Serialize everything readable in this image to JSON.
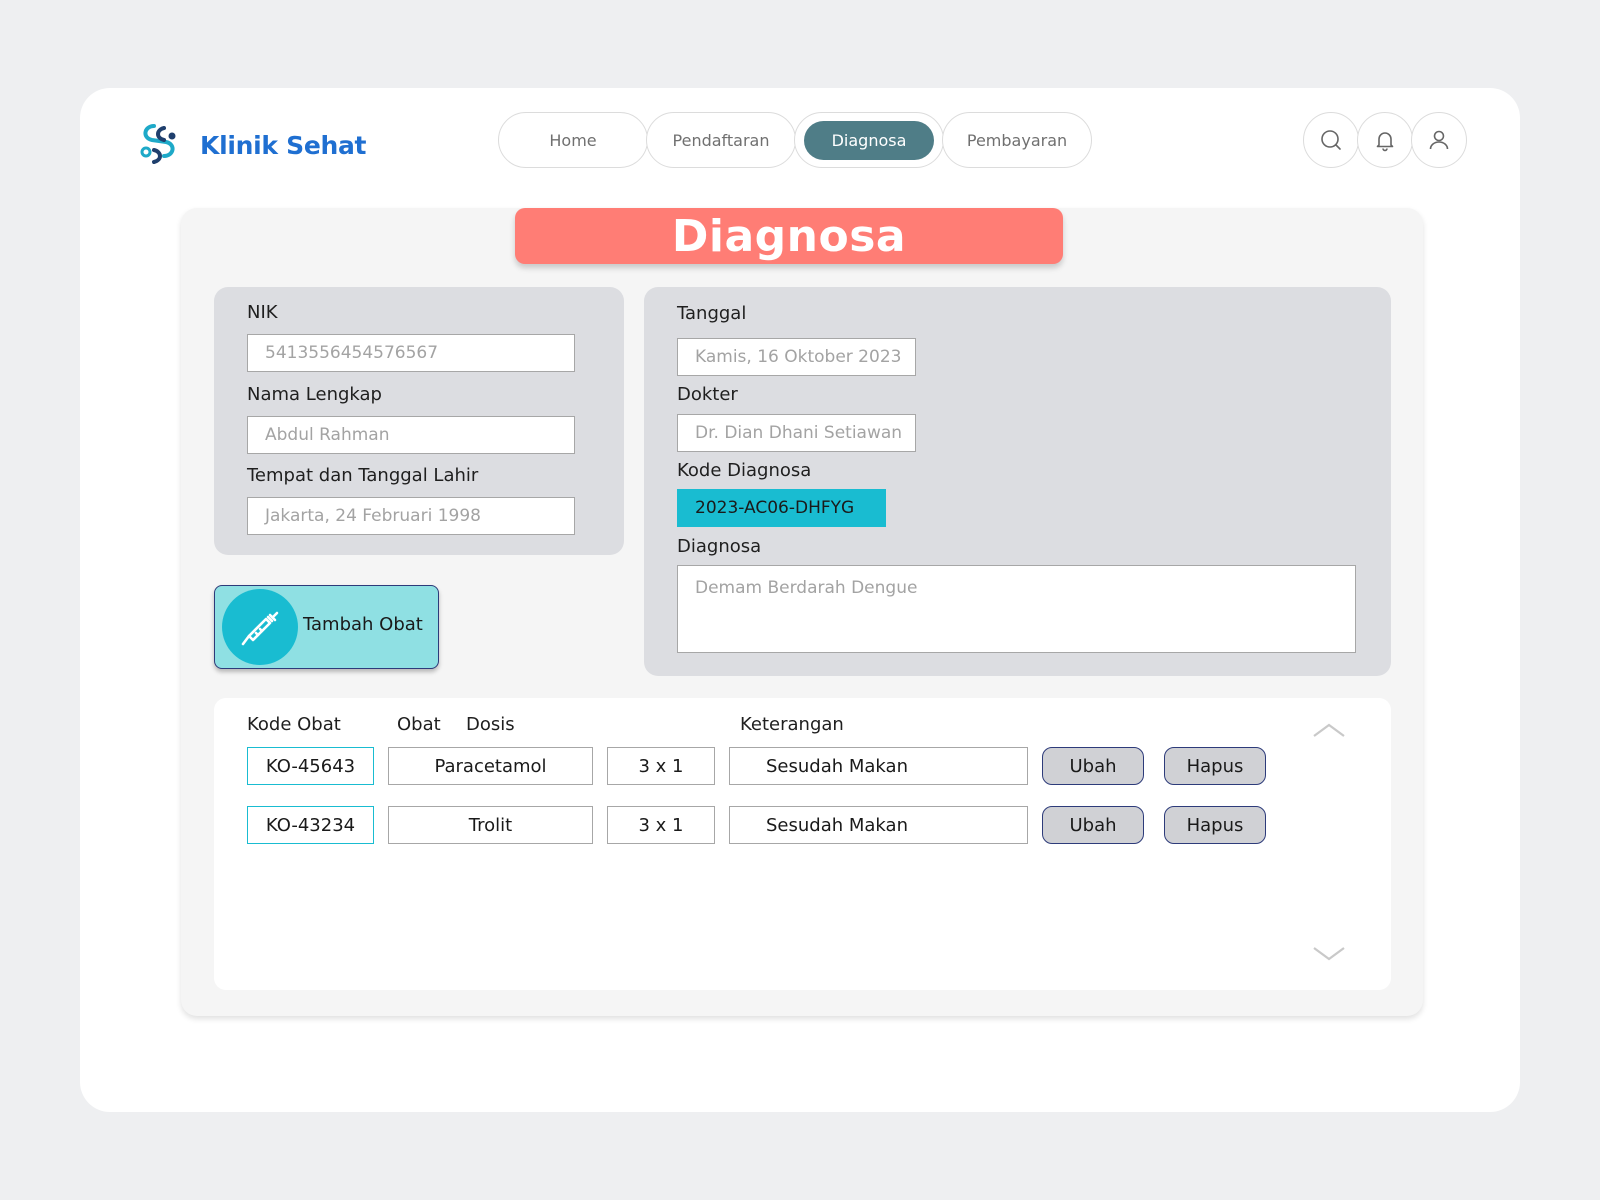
{
  "brand": {
    "name": "Klinik Sehat",
    "logo_icon": "stethoscope-logo-icon"
  },
  "nav": {
    "tabs": [
      {
        "label": "Home",
        "active": false
      },
      {
        "label": "Pendaftaran",
        "active": false
      },
      {
        "label": "Diagnosa",
        "active": true
      },
      {
        "label": "Pembayaran",
        "active": false
      }
    ]
  },
  "header_icons": [
    "search-icon",
    "bell-icon",
    "user-icon"
  ],
  "page": {
    "title": "Diagnosa"
  },
  "patient": {
    "nik_label": "NIK",
    "nik_value": "5413556454576567",
    "name_label": "Nama Lengkap",
    "name_value": "Abdul Rahman",
    "birth_label": "Tempat dan Tanggal Lahir",
    "birth_value": "Jakarta, 24 Februari 1998"
  },
  "visit": {
    "date_label": "Tanggal",
    "date_value": "Kamis, 16 Oktober 2023",
    "doctor_label": "Dokter",
    "doctor_value": "Dr. Dian Dhani Setiawan",
    "code_label": "Kode Diagnosa",
    "code_value": "2023-AC06-DHFYG",
    "diagnosis_label": "Diagnosa",
    "diagnosis_value": "Demam Berdarah Dengue"
  },
  "add_medicine": {
    "label": "Tambah Obat",
    "icon": "syringe-icon"
  },
  "medicine_table": {
    "headers": {
      "code": "Kode Obat",
      "name": "Obat",
      "dose": "Dosis",
      "note": "Keterangan"
    },
    "rows": [
      {
        "code": "KO-45643",
        "name": "Paracetamol",
        "dose": "3 x 1",
        "note": "Sesudah Makan",
        "edit": "Ubah",
        "delete": "Hapus"
      },
      {
        "code": "KO-43234",
        "name": "Trolit",
        "dose": "3 x 1",
        "note": "Sesudah Makan",
        "edit": "Ubah",
        "delete": "Hapus"
      }
    ]
  },
  "colors": {
    "background": "#eeeff1",
    "brand_blue": "#1f6fd1",
    "nav_active": "#4f7d87",
    "title_banner": "#ff7d75",
    "accent_cyan": "#19bcd1",
    "add_button": "#8fe0e3",
    "button_border": "#2d3b7a"
  }
}
